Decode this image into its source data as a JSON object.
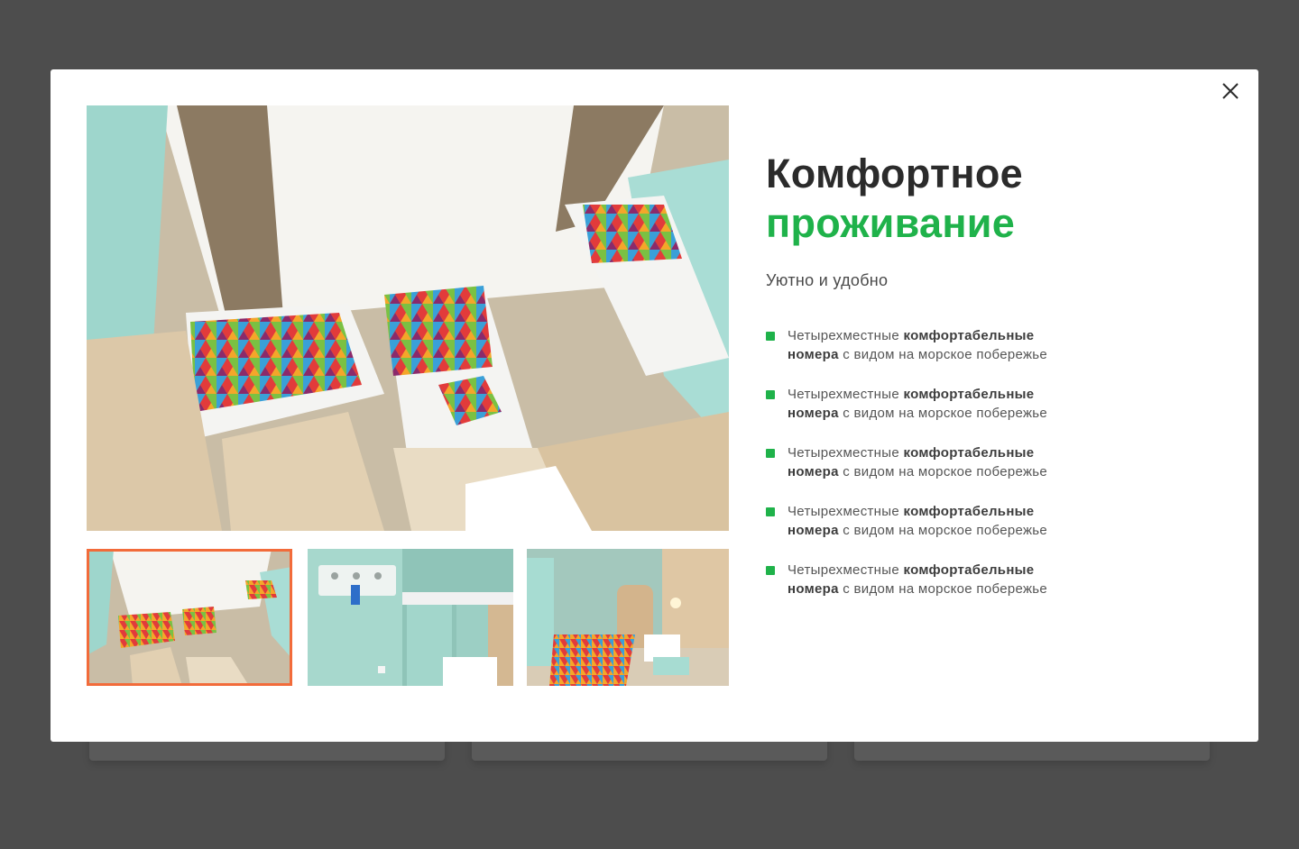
{
  "modal": {
    "title_line1": "Комфортное",
    "title_line2": "проживание",
    "subtitle": "Уютно и удобно",
    "features": [
      {
        "prefix": "Четырехместные ",
        "bold1": "комфортабельные",
        "bold2": "номера",
        "suffix": " с видом на морское побережье"
      },
      {
        "prefix": "Четырехместные ",
        "bold1": "комфортабельные",
        "bold2": "номера",
        "suffix": " с видом на морское побережье"
      },
      {
        "prefix": "Четырехместные ",
        "bold1": "комфортабельные",
        "bold2": "номера",
        "suffix": " с видом на морское побережье"
      },
      {
        "prefix": "Четырехместные ",
        "bold1": "комфортабельные",
        "bold2": "номера",
        "suffix": " с видом на морское побережье"
      },
      {
        "prefix": "Четырехместные ",
        "bold1": "комфортабельные",
        "bold2": "номера",
        "suffix": " с видом на морское побережье"
      }
    ],
    "close_icon": "close-icon",
    "active_thumbnail": 1
  },
  "colors": {
    "accent_green": "#1fb24a",
    "thumb_active_border": "#f26b3a",
    "overlay": "#4d4d4d"
  }
}
